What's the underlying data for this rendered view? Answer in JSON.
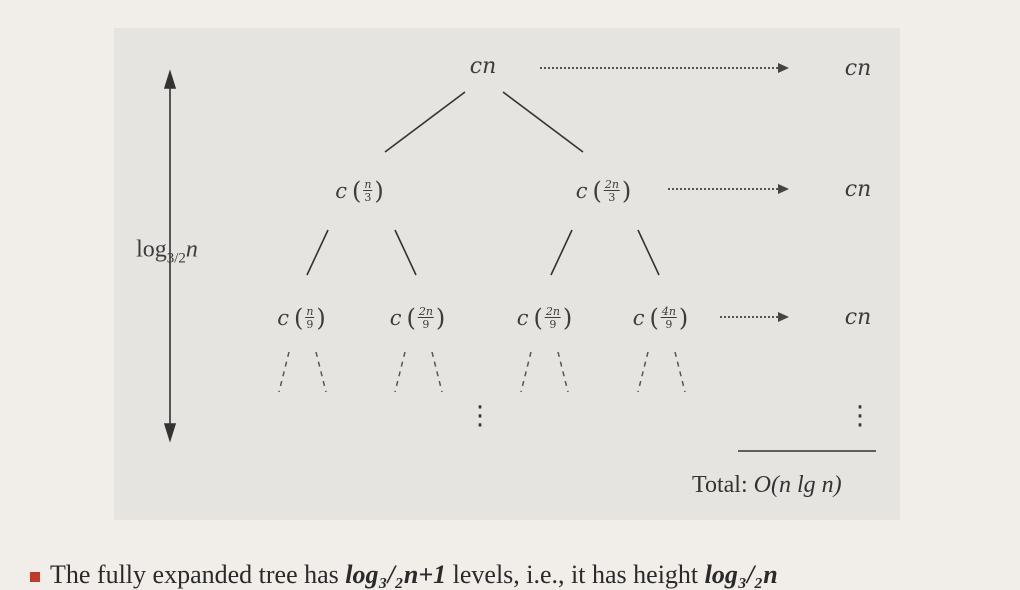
{
  "tree": {
    "root": "cn",
    "level1": [
      {
        "coef": "c",
        "num": "n",
        "den": "3"
      },
      {
        "coef": "c",
        "num": "2n",
        "den": "3"
      }
    ],
    "level2": [
      {
        "coef": "c",
        "num": "n",
        "den": "9"
      },
      {
        "coef": "c",
        "num": "2n",
        "den": "9"
      },
      {
        "coef": "c",
        "num": "2n",
        "den": "9"
      },
      {
        "coef": "c",
        "num": "4n",
        "den": "9"
      }
    ]
  },
  "level_costs": [
    "cn",
    "cn",
    "cn"
  ],
  "height_label": {
    "base": "log",
    "sub": "3/2",
    "var": "n"
  },
  "total": {
    "prefix": "Total:",
    "value": "O(n lg n)"
  },
  "caption": {
    "text_before": "The fully expanded tree has ",
    "bold1": "log₃/₂n+1",
    "text_mid": " levels, i.e., it has height ",
    "bold2": "log₃/₂n"
  }
}
